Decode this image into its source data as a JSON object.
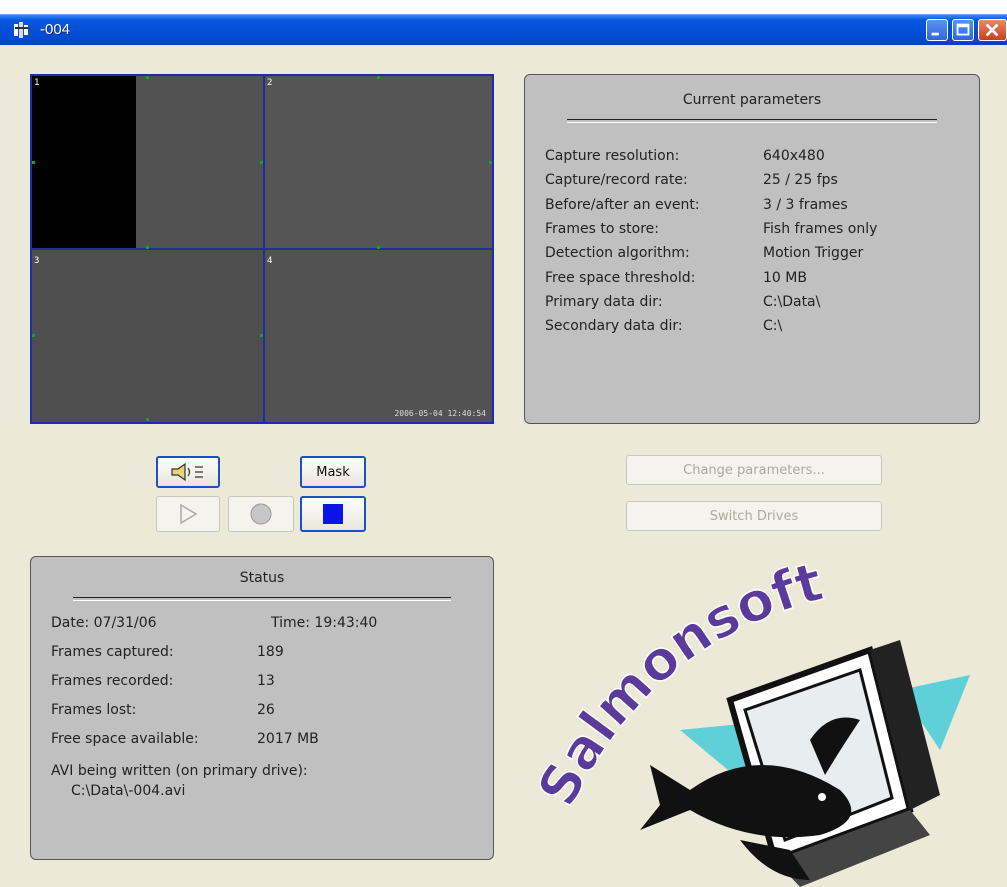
{
  "window": {
    "title": "-004"
  },
  "video": {
    "cells": [
      "1",
      "2",
      "3",
      "4"
    ],
    "timestamp": "2006-05-04 12:40:54"
  },
  "params": {
    "title": "Current parameters",
    "rows": [
      {
        "label": "Capture resolution:",
        "value": "640x480"
      },
      {
        "label": "Capture/record rate:",
        "value": "25 / 25 fps"
      },
      {
        "label": "Before/after an event:",
        "value": "3 / 3 frames"
      },
      {
        "label": "Frames to store:",
        "value": "Fish frames only"
      },
      {
        "label": "Detection algorithm:",
        "value": "Motion Trigger"
      },
      {
        "label": "Free space threshold:",
        "value": "10 MB"
      },
      {
        "label": "Primary data dir:",
        "value": "C:\\Data\\"
      },
      {
        "label": "Secondary data dir:",
        "value": "C:\\"
      }
    ]
  },
  "controls": {
    "sound_icon": "speaker-icon",
    "mask_label": "Mask",
    "play_icon": "play-icon",
    "record_icon": "record-icon",
    "stop_icon": "stop-icon",
    "change_params_label": "Change parameters...",
    "switch_drives_label": "Switch Drives"
  },
  "status": {
    "title": "Status",
    "date_label": "Date: 07/31/06",
    "time_label": "Time: 19:43:40",
    "rows": [
      {
        "label": "Frames captured:",
        "value": "189"
      },
      {
        "label": "Frames recorded:",
        "value": "13"
      },
      {
        "label": "Frames lost:",
        "value": "26"
      },
      {
        "label": "Free space available:",
        "value": "2017 MB"
      }
    ],
    "avi_label": "AVI being written (on primary drive):",
    "avi_path": "C:\\Data\\-004.avi"
  },
  "logo": {
    "text": "Salmonsoft"
  },
  "colors": {
    "titlebar": "#0550d8",
    "video_border": "#1b2ea8",
    "groupbox": "#c0c0c0",
    "logo_text": "#5a3a9a",
    "logo_accent": "#5fd0d8"
  }
}
